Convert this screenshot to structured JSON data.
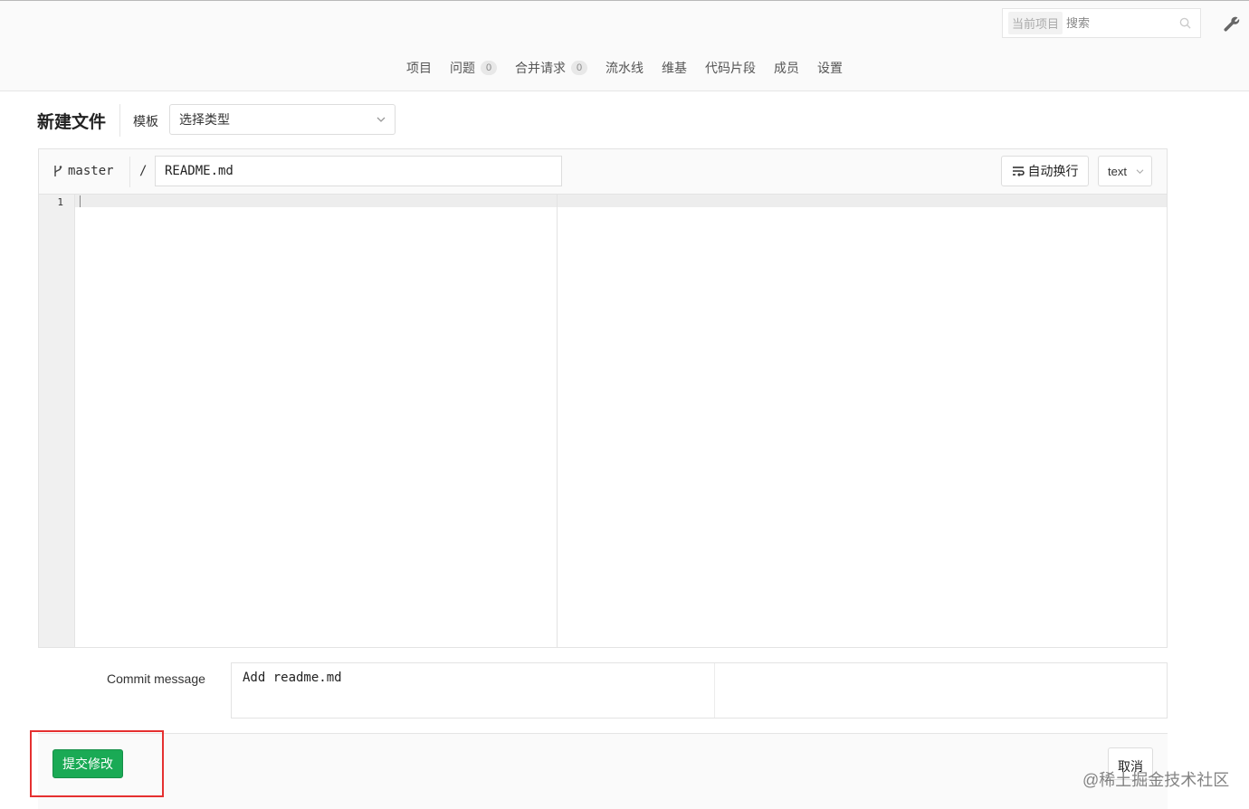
{
  "header": {
    "search_scope": "当前项目",
    "search_placeholder": "搜索",
    "icons": [
      "search-icon",
      "wrench-icon"
    ]
  },
  "nav": {
    "items": [
      {
        "label": "项目"
      },
      {
        "label": "问题",
        "count": "0"
      },
      {
        "label": "合并请求",
        "count": "0"
      },
      {
        "label": "流水线"
      },
      {
        "label": "维基"
      },
      {
        "label": "代码片段"
      },
      {
        "label": "成员"
      },
      {
        "label": "设置"
      }
    ]
  },
  "page": {
    "title": "新建文件",
    "template_label": "模板",
    "template_value": "选择类型"
  },
  "editor": {
    "branch": "master",
    "path_separator": "/",
    "file_name": "README.md",
    "wrap_label": "自动换行",
    "language": "text",
    "line_numbers": [
      "1"
    ]
  },
  "commit": {
    "label": "Commit message",
    "message": "Add readme.md"
  },
  "actions": {
    "submit_label": "提交修改",
    "cancel_label": "取消",
    "submit_color": "#1aaa55",
    "highlight_color": "#e53030"
  },
  "watermark": "@稀土掘金技术社区"
}
